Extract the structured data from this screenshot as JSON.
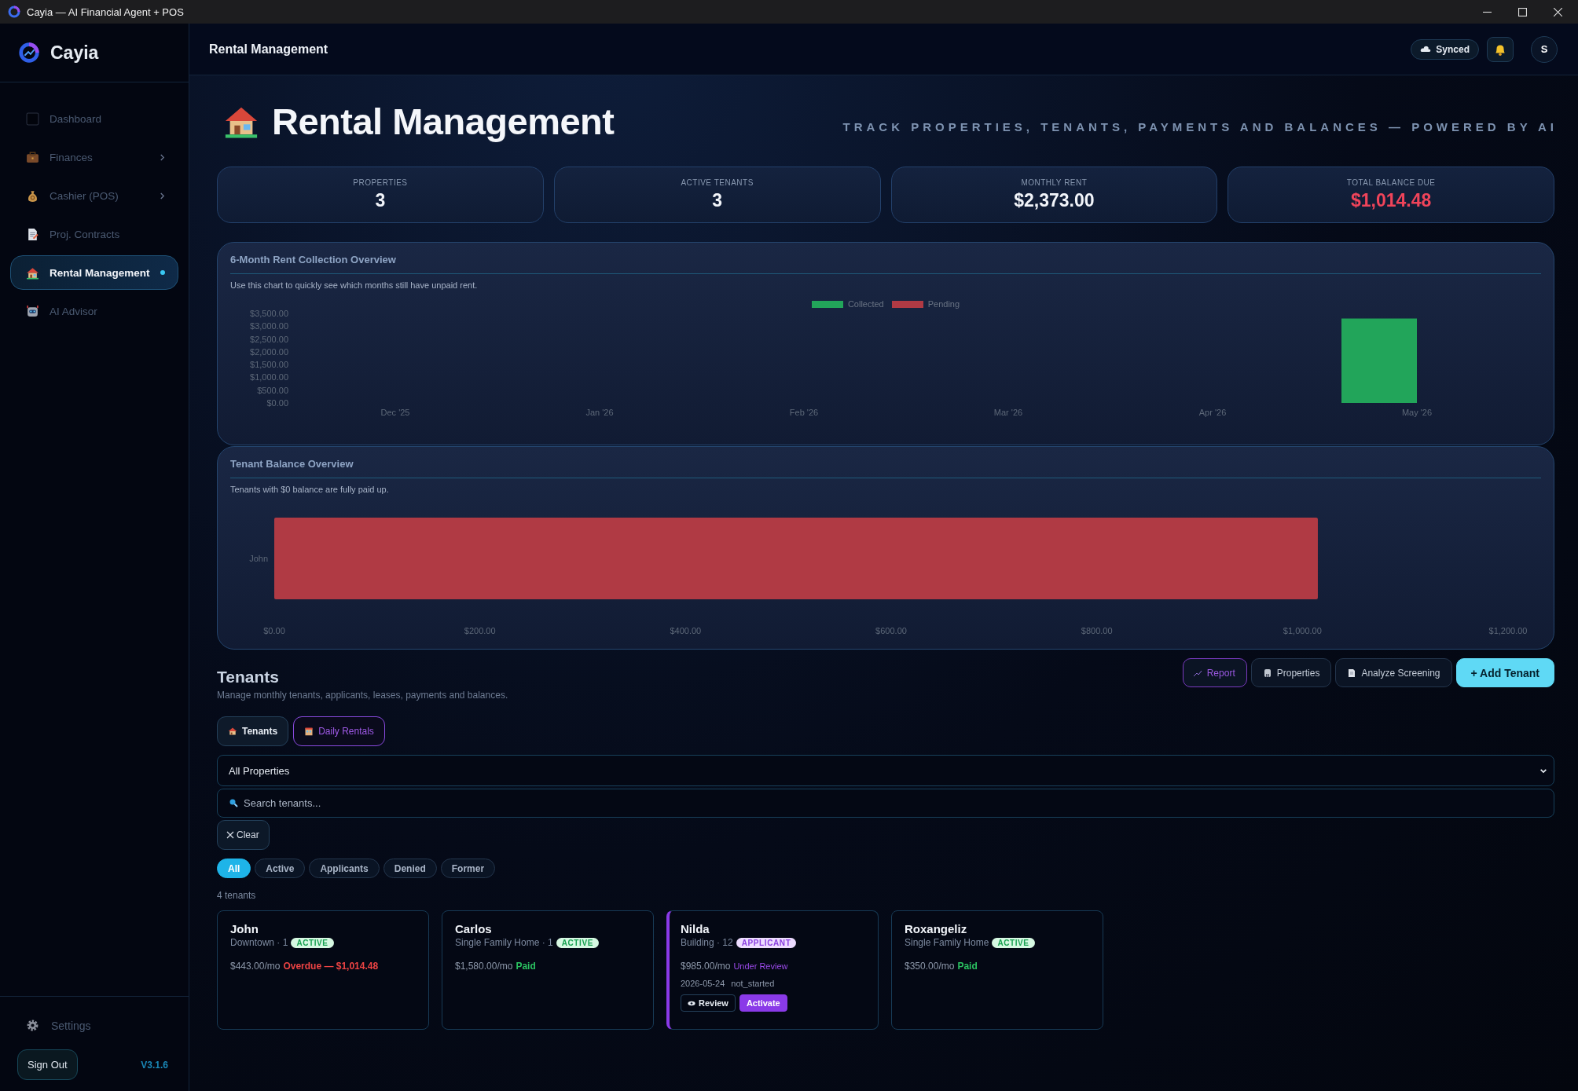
{
  "window": {
    "title": "Cayia — AI Financial Agent + POS"
  },
  "sidebar": {
    "brand": "Cayia",
    "items": [
      {
        "label": "Dashboard",
        "selected": false,
        "submenu": false
      },
      {
        "label": "Finances",
        "selected": false,
        "submenu": true
      },
      {
        "label": "Cashier (POS)",
        "selected": false,
        "submenu": true
      },
      {
        "label": "Proj. Contracts",
        "selected": false,
        "submenu": false
      },
      {
        "label": "Rental Management",
        "selected": true,
        "submenu": false
      },
      {
        "label": "AI Advisor",
        "selected": false,
        "submenu": false
      }
    ],
    "settings": "Settings",
    "sign_out": "Sign Out",
    "version": "V3.1.6"
  },
  "header": {
    "title": "Rental Management",
    "sync_status": "Synced",
    "avatar": "S"
  },
  "page": {
    "title": "Rental Management",
    "tagline": "TRACK PROPERTIES, TENANTS, PAYMENTS AND BALANCES — POWERED BY AI"
  },
  "stats": [
    {
      "label": "PROPERTIES",
      "value": "3",
      "alert": false
    },
    {
      "label": "ACTIVE TENANTS",
      "value": "3",
      "alert": false
    },
    {
      "label": "MONTHLY RENT",
      "value": "$2,373.00",
      "alert": false
    },
    {
      "label": "TOTAL BALANCE DUE",
      "value": "$1,014.48",
      "alert": true
    }
  ],
  "rent_chart": {
    "title": "6-Month Rent Collection Overview",
    "subtitle": "Use this chart to quickly see which months still have unpaid rent.",
    "chart_data": {
      "type": "bar",
      "categories": [
        "Dec '25",
        "Jan '26",
        "Feb '26",
        "Mar '26",
        "Apr '26",
        "May '26"
      ],
      "series": [
        {
          "name": "Collected",
          "color": "#22a55a",
          "values": [
            0,
            0,
            0,
            0,
            0,
            3300
          ]
        },
        {
          "name": "Pending",
          "color": "#b03a44",
          "values": [
            0,
            0,
            0,
            0,
            0,
            0
          ]
        }
      ],
      "ylim": [
        0,
        3500
      ],
      "yticks": [
        {
          "value": 0,
          "label": "$0.00"
        },
        {
          "value": 500,
          "label": "$500.00"
        },
        {
          "value": 1000,
          "label": "$1,000.00"
        },
        {
          "value": 1500,
          "label": "$1,500.00"
        },
        {
          "value": 2000,
          "label": "$2,000.00"
        },
        {
          "value": 2500,
          "label": "$2,500.00"
        },
        {
          "value": 3000,
          "label": "$3,000.00"
        },
        {
          "value": 3500,
          "label": "$3,500.00"
        }
      ]
    }
  },
  "balance_chart": {
    "title": "Tenant Balance Overview",
    "subtitle": "Tenants with $0 balance are fully paid up.",
    "chart_data": {
      "type": "bar",
      "orientation": "horizontal",
      "categories": [
        "John"
      ],
      "series": [
        {
          "color": "#b03a44",
          "values": [
            1015
          ]
        }
      ],
      "xlim": [
        0,
        1200
      ],
      "xticks": [
        {
          "value": 0,
          "label": "$0.00"
        },
        {
          "value": 200,
          "label": "$200.00"
        },
        {
          "value": 400,
          "label": "$400.00"
        },
        {
          "value": 600,
          "label": "$600.00"
        },
        {
          "value": 800,
          "label": "$800.00"
        },
        {
          "value": 1000,
          "label": "$1,000.00"
        },
        {
          "value": 1200,
          "label": "$1,200.00"
        }
      ]
    }
  },
  "tenants": {
    "title": "Tenants",
    "subtitle": "Manage monthly tenants, applicants, leases, payments and balances.",
    "actions": [
      {
        "label": "Report",
        "kind": "accent"
      },
      {
        "label": "Properties",
        "kind": "default"
      },
      {
        "label": "Analyze Screening",
        "kind": "default"
      },
      {
        "label": "+ Add Tenant",
        "kind": "primary"
      }
    ],
    "tabs": [
      {
        "label": "Tenants",
        "selected": true
      },
      {
        "label": "Daily Rentals",
        "selected": false
      }
    ],
    "property_filter": {
      "value": "All Properties"
    },
    "search": {
      "placeholder": "Search tenants..."
    },
    "clear_button": "Clear",
    "status_filters": [
      {
        "label": "All",
        "selected": true
      },
      {
        "label": "Active",
        "selected": false
      },
      {
        "label": "Applicants",
        "selected": false
      },
      {
        "label": "Denied",
        "selected": false
      },
      {
        "label": "Former",
        "selected": false
      }
    ],
    "count": "4 tenants",
    "cards": [
      {
        "name": "John",
        "property": "Downtown · 1",
        "status": {
          "label": "ACTIVE",
          "kind": "active"
        },
        "rent": "$443.00/mo",
        "payment": {
          "label": "Overdue — $1,014.48",
          "kind": "overdue"
        },
        "highlighted": false
      },
      {
        "name": "Carlos",
        "property": "Single Family Home · 1",
        "status": {
          "label": "ACTIVE",
          "kind": "active"
        },
        "rent": "$1,580.00/mo",
        "payment": {
          "label": "Paid",
          "kind": "paid"
        },
        "highlighted": false
      },
      {
        "name": "Nilda",
        "property": "Building · 12",
        "status": {
          "label": "APPLICANT",
          "kind": "applicant"
        },
        "rent": "$985.00/mo",
        "payment": {
          "label": "Under Review",
          "kind": "review"
        },
        "highlighted": true,
        "date": "2026-05-24",
        "screening": "not_started",
        "buttons": [
          {
            "label": "Review",
            "kind": "outline"
          },
          {
            "label": "Activate",
            "kind": "primary"
          }
        ]
      },
      {
        "name": "Roxangeliz",
        "property": "Single Family Home",
        "status": {
          "label": "ACTIVE",
          "kind": "active"
        },
        "rent": "$350.00/mo",
        "payment": {
          "label": "Paid",
          "kind": "paid"
        },
        "highlighted": false
      }
    ]
  }
}
